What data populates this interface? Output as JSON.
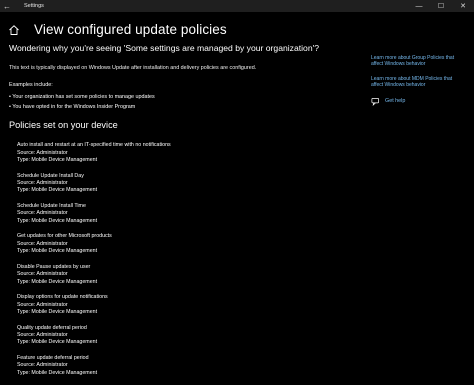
{
  "window": {
    "title": "Settings",
    "back_glyph": "←",
    "minimize_glyph": "—",
    "maximize_glyph": "☐",
    "close_glyph": "✕"
  },
  "header": {
    "title": "View configured update policies",
    "home_icon": "home-icon"
  },
  "main": {
    "question": "Wondering why you're seeing 'Some settings are managed by your organization'?",
    "description": "This text is typically displayed on Windows Update after installation and delivery policies are configured.",
    "examples_label": "Examples include:",
    "examples": [
      "• Your organization has set some policies to manage updates",
      "• You have opted in for the Windows Insider Program"
    ],
    "section_title": "Policies set on your device",
    "policies": [
      {
        "name": "Auto install and restart at an IT-specified time with no notifications",
        "source1": "Source: Administrator",
        "source2": "Type: Mobile Device Management"
      },
      {
        "name": "Schedule Update Install Day",
        "source1": "Source: Administrator",
        "source2": "Type: Mobile Device Management"
      },
      {
        "name": "Schedule Update Install Time",
        "source1": "Source: Administrator",
        "source2": "Type: Mobile Device Management"
      },
      {
        "name": "Get updates for other Microsoft products",
        "source1": "Source: Administrator",
        "source2": "Type: Mobile Device Management"
      },
      {
        "name": "Disable Pause updates by user",
        "source1": "Source: Administrator",
        "source2": "Type: Mobile Device Management"
      },
      {
        "name": "Display options for update notifications",
        "source1": "Source: Administrator",
        "source2": "Type: Mobile Device Management"
      },
      {
        "name": "Quality update deferral period",
        "source1": "Source: Administrator",
        "source2": "Type: Mobile Device Management"
      },
      {
        "name": "Feature update deferral period",
        "source1": "Source: Administrator",
        "source2": "Type: Mobile Device Management"
      }
    ]
  },
  "sidebar": {
    "links": [
      {
        "line1": "Learn more about Group Policies that",
        "line2": "affect Windows behavior"
      },
      {
        "line1": "Learn more about MDM Policies that",
        "line2": "affect Windows behavior"
      }
    ],
    "help_label": "Get help",
    "help_icon": "help-chat-icon"
  },
  "colors": {
    "background": "#000000",
    "titlebar": "#1f1f1f",
    "link": "#76b9ed",
    "text": "#ffffff"
  }
}
